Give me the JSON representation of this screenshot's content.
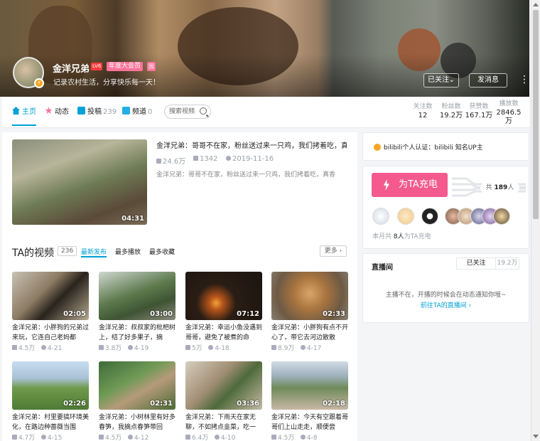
{
  "header": {
    "username": "金洋兄弟",
    "level": "LV6",
    "vip_badge": "年度大会员",
    "vip_icon": "国",
    "signature": "记录农村生活，分享快乐每一天！",
    "follow_label": "已关注",
    "message_label": "发消息",
    "more_icon": "more-dots-icon"
  },
  "nav": {
    "tabs": [
      {
        "label": "主页",
        "count": "",
        "icon": "home-icon"
      },
      {
        "label": "动态",
        "count": "",
        "icon": "dynamic-icon"
      },
      {
        "label": "投稿",
        "count": "239",
        "icon": "upload-icon"
      },
      {
        "label": "频道",
        "count": "0",
        "icon": "channel-icon"
      }
    ],
    "search_placeholder": "搜索视频",
    "stats": [
      {
        "label": "关注数",
        "value": "12"
      },
      {
        "label": "粉丝数",
        "value": "19.2万"
      },
      {
        "label": "获赞数",
        "value": "167.1万"
      },
      {
        "label": "播放数",
        "value": "2846.5万"
      }
    ]
  },
  "featured": {
    "title": "金洋兄弟：哥哥不在家，粉丝送过来一只鸡，我们拷着吃，真香",
    "plays": "24.6万",
    "danmaku": "1342",
    "date": "2019-11-16",
    "desc": "金洋兄弟：哥哥不在家，粉丝送过来一只鸡，我们拷着吃，真香",
    "duration": "04:31"
  },
  "videos_section": {
    "title": "TA的视频",
    "count": "236",
    "sorts": [
      "最新发布",
      "最多播放",
      "最多收藏"
    ],
    "more": "更多"
  },
  "videos": [
    {
      "title": "金洋兄弟：小胖狗的兄弟过来玩，它连自己老妈都",
      "plays": "4.5万",
      "date": "4-21",
      "duration": "02:05"
    },
    {
      "title": "金洋兄弟：叔叔家的枇杷树上，结了好多果子，摘",
      "plays": "3.8万",
      "date": "4-19",
      "duration": "03:00"
    },
    {
      "title": "金洋兄弟：幸运小鱼没遇到哥哥，避免了被煮的命",
      "plays": "5万",
      "date": "4-18",
      "duration": "07:12"
    },
    {
      "title": "金洋兄弟：小胖狗有点不开心了，带它去河边散散",
      "plays": "8.9万",
      "date": "4-17",
      "duration": "02:33"
    },
    {
      "title": "金洋兄弟：村里要搞环境美化，在路边种蔷薇当围",
      "plays": "4.7万",
      "date": "4-15",
      "duration": "02:26"
    },
    {
      "title": "金洋兄弟：小树林里有好多春笋，我摘点春笋带回",
      "plays": "4.5万",
      "date": "4-12",
      "duration": "02:31"
    },
    {
      "title": "金洋兄弟：下雨天在家无聊，不如拷点韭菜，吃一",
      "plays": "6.4万",
      "date": "4-10",
      "duration": "03:36"
    },
    {
      "title": "金洋兄弟：今天有空跟着哥哥们上山走走，顺便尝",
      "plays": "4.5万",
      "date": "4-8",
      "duration": "02:18"
    }
  ],
  "sidebar": {
    "auth": "bilibili个人认证：bilibili 知名UP主",
    "charge_label": "为TA充电",
    "total_prefix": "共",
    "total_count": "189",
    "total_suffix": "人",
    "month_prefix": "本月共",
    "month_count": "8人",
    "month_suffix": "为TA充电",
    "live_title": "直播间",
    "live_follow": "已关注",
    "live_fans": "19.2万",
    "live_msg": "主播不在，开播的时候会在动态通知你哦~",
    "live_link": "前往TA的直播间"
  },
  "colors": {
    "accent": "#00a1d6",
    "pink": "#fb7299",
    "charge": "#f45a8d"
  }
}
